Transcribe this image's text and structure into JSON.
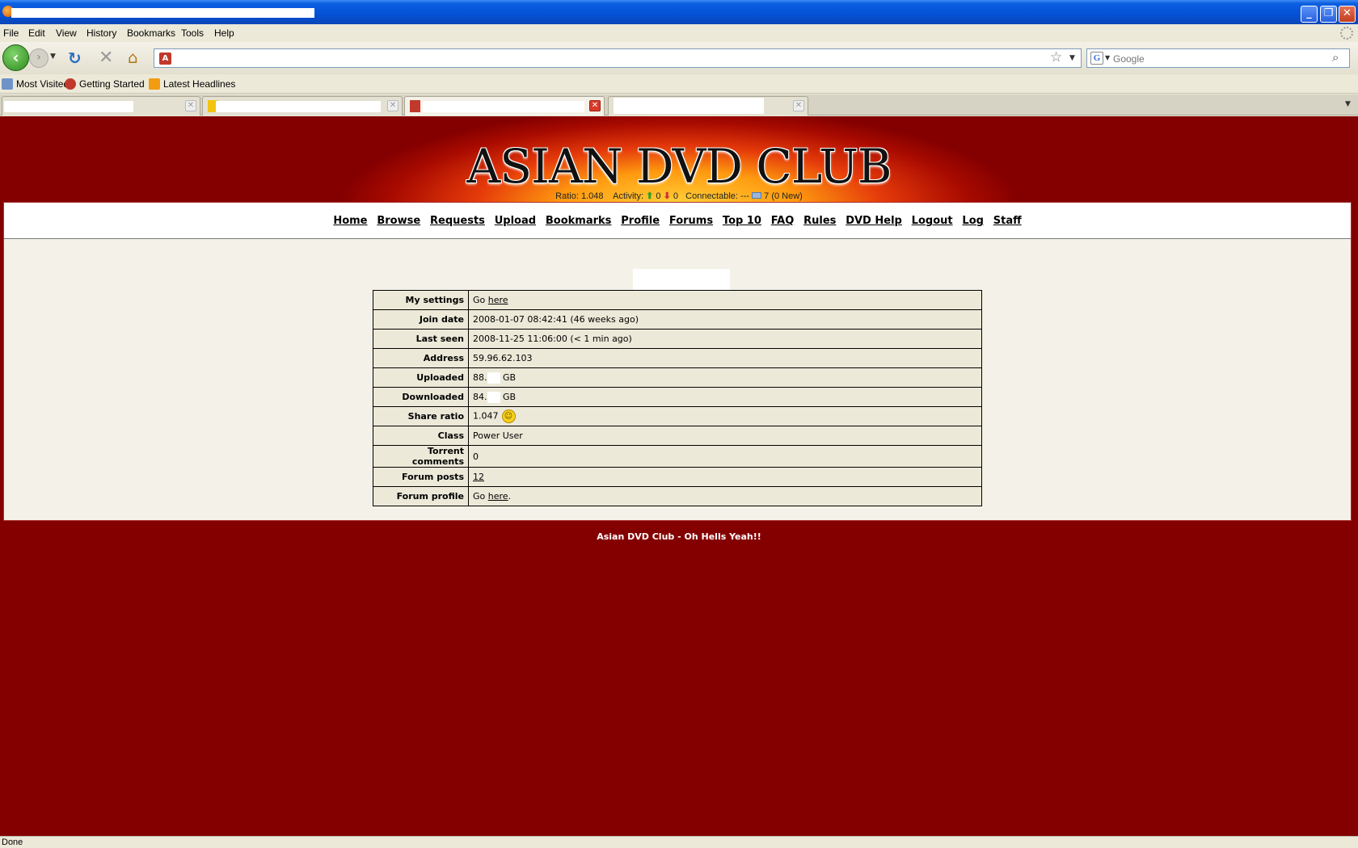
{
  "window": {
    "minimize": "_",
    "maximize": "❐",
    "close": "✕"
  },
  "menu": [
    "File",
    "Edit",
    "View",
    "History",
    "Bookmarks",
    "Tools",
    "Help"
  ],
  "toolbar": {
    "back": "‹",
    "forward": "›",
    "reload": "↻",
    "stop": "✕",
    "home": "⌂",
    "url": "",
    "star": "☆"
  },
  "search": {
    "engine": "G",
    "placeholder": "Google"
  },
  "bookmarks": [
    "Most Visited",
    "Getting Started",
    "Latest Headlines"
  ],
  "site": {
    "logo": "ASIAN DVD CLUB",
    "status": {
      "ratio_label": "Ratio:",
      "ratio": "1.048",
      "activity_label": "Activity:",
      "seeding": "0",
      "leeching": "0",
      "connectable_label": "Connectable:",
      "connectable": "---",
      "messages": "7 (0 New)"
    },
    "nav": [
      "Home",
      "Browse",
      "Requests",
      "Upload",
      "Bookmarks",
      "Profile",
      "Forums",
      "Top 10",
      "FAQ",
      "Rules",
      "DVD Help",
      "Logout",
      "Log",
      "Staff"
    ],
    "profile": {
      "settings_label": "My settings",
      "settings_prefix": "Go",
      "settings_link": "here",
      "join_label": "Join date",
      "join": "2008-01-07 08:42:41 (46 weeks ago)",
      "seen_label": "Last seen",
      "seen": "2008-11-25 11:06:00 (< 1 min ago)",
      "address_label": "Address",
      "address": "59.96.62.103",
      "uploaded_label": "Uploaded",
      "uploaded_prefix": "88.",
      "uploaded_unit": "GB",
      "downloaded_label": "Downloaded",
      "downloaded_prefix": "84.",
      "downloaded_unit": "GB",
      "ratio_label": "Share ratio",
      "ratio": "1.047",
      "class_label": "Class",
      "class": "Power User",
      "comments_label": "Torrent comments",
      "comments": "0",
      "posts_label": "Forum posts",
      "posts": "12",
      "forum_label": "Forum profile",
      "forum_prefix": "Go",
      "forum_link": "here",
      "forum_suffix": "."
    },
    "footer": "Asian DVD Club - Oh Hells Yeah!!"
  },
  "statusbar": "Done"
}
